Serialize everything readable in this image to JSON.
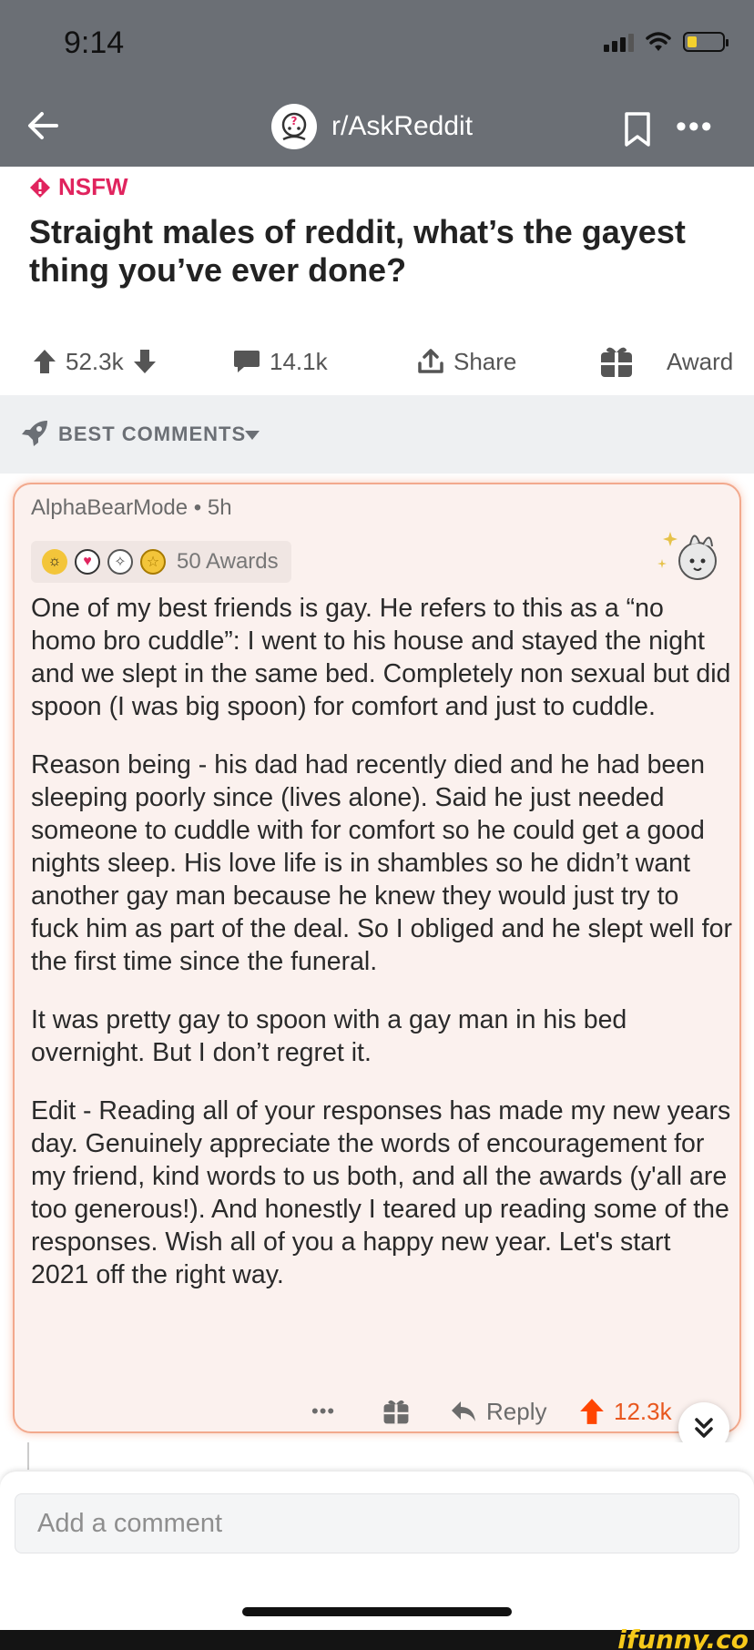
{
  "status_bar": {
    "time": "9:14"
  },
  "header": {
    "subreddit": "r/AskReddit"
  },
  "post": {
    "nsfw_label": "NSFW",
    "title": "Straight males of reddit, what’s the gayest thing you’ve ever done?",
    "upvotes": "52.3k",
    "comments": "14.1k",
    "share_label": "Share",
    "award_label": "Award"
  },
  "sort": {
    "label": "BEST COMMENTS"
  },
  "comment": {
    "author": "AlphaBearMode",
    "age": "5h",
    "meta": "AlphaBearMode • 5h",
    "awards_count": "50 Awards",
    "paragraphs": [
      "One of my best friends is gay. He refers to this as a “no homo bro cuddle”: I went to his house and stayed the night and we slept in the same bed. Completely non sexual but did spoon (I was big spoon) for comfort and just to cuddle.",
      "Reason being - his dad had recently died and he had been sleeping poorly since (lives alone). Said he just needed someone to cuddle with for comfort so he could get a good nights sleep. His love life is in shambles so he didn’t want another gay man because he knew they would just try to fuck him as part of the deal. So I obliged and he slept well for the first time since the funeral.",
      "It was pretty gay to spoon with a gay man in his bed overnight. But I don’t regret it.",
      "Edit - Reading all of your responses has made my new years day. Genuinely appreciate the words of encouragement for my friend, kind words to us both, and all the awards (y'all are too generous!). And honestly I teared up reading some of the responses. Wish all of you a happy new year. Let's start 2021 off the right way."
    ],
    "reply_label": "Reply",
    "score": "12.3k"
  },
  "composer": {
    "placeholder": "Add a comment"
  },
  "watermark": "ifunny.co",
  "colors": {
    "header_bg": "#6b6f75",
    "nsfw": "#e0245e",
    "upvote_active": "#ff4500",
    "highlight_border": "#f2a98d"
  },
  "icons": [
    "back-arrow-icon",
    "subreddit-icon",
    "bookmark-icon",
    "more-icon",
    "upvote-icon",
    "downvote-icon",
    "comment-icon",
    "share-icon",
    "gift-icon",
    "rocket-icon",
    "chevron-down-icon",
    "reply-icon",
    "double-chevron-down-icon"
  ]
}
